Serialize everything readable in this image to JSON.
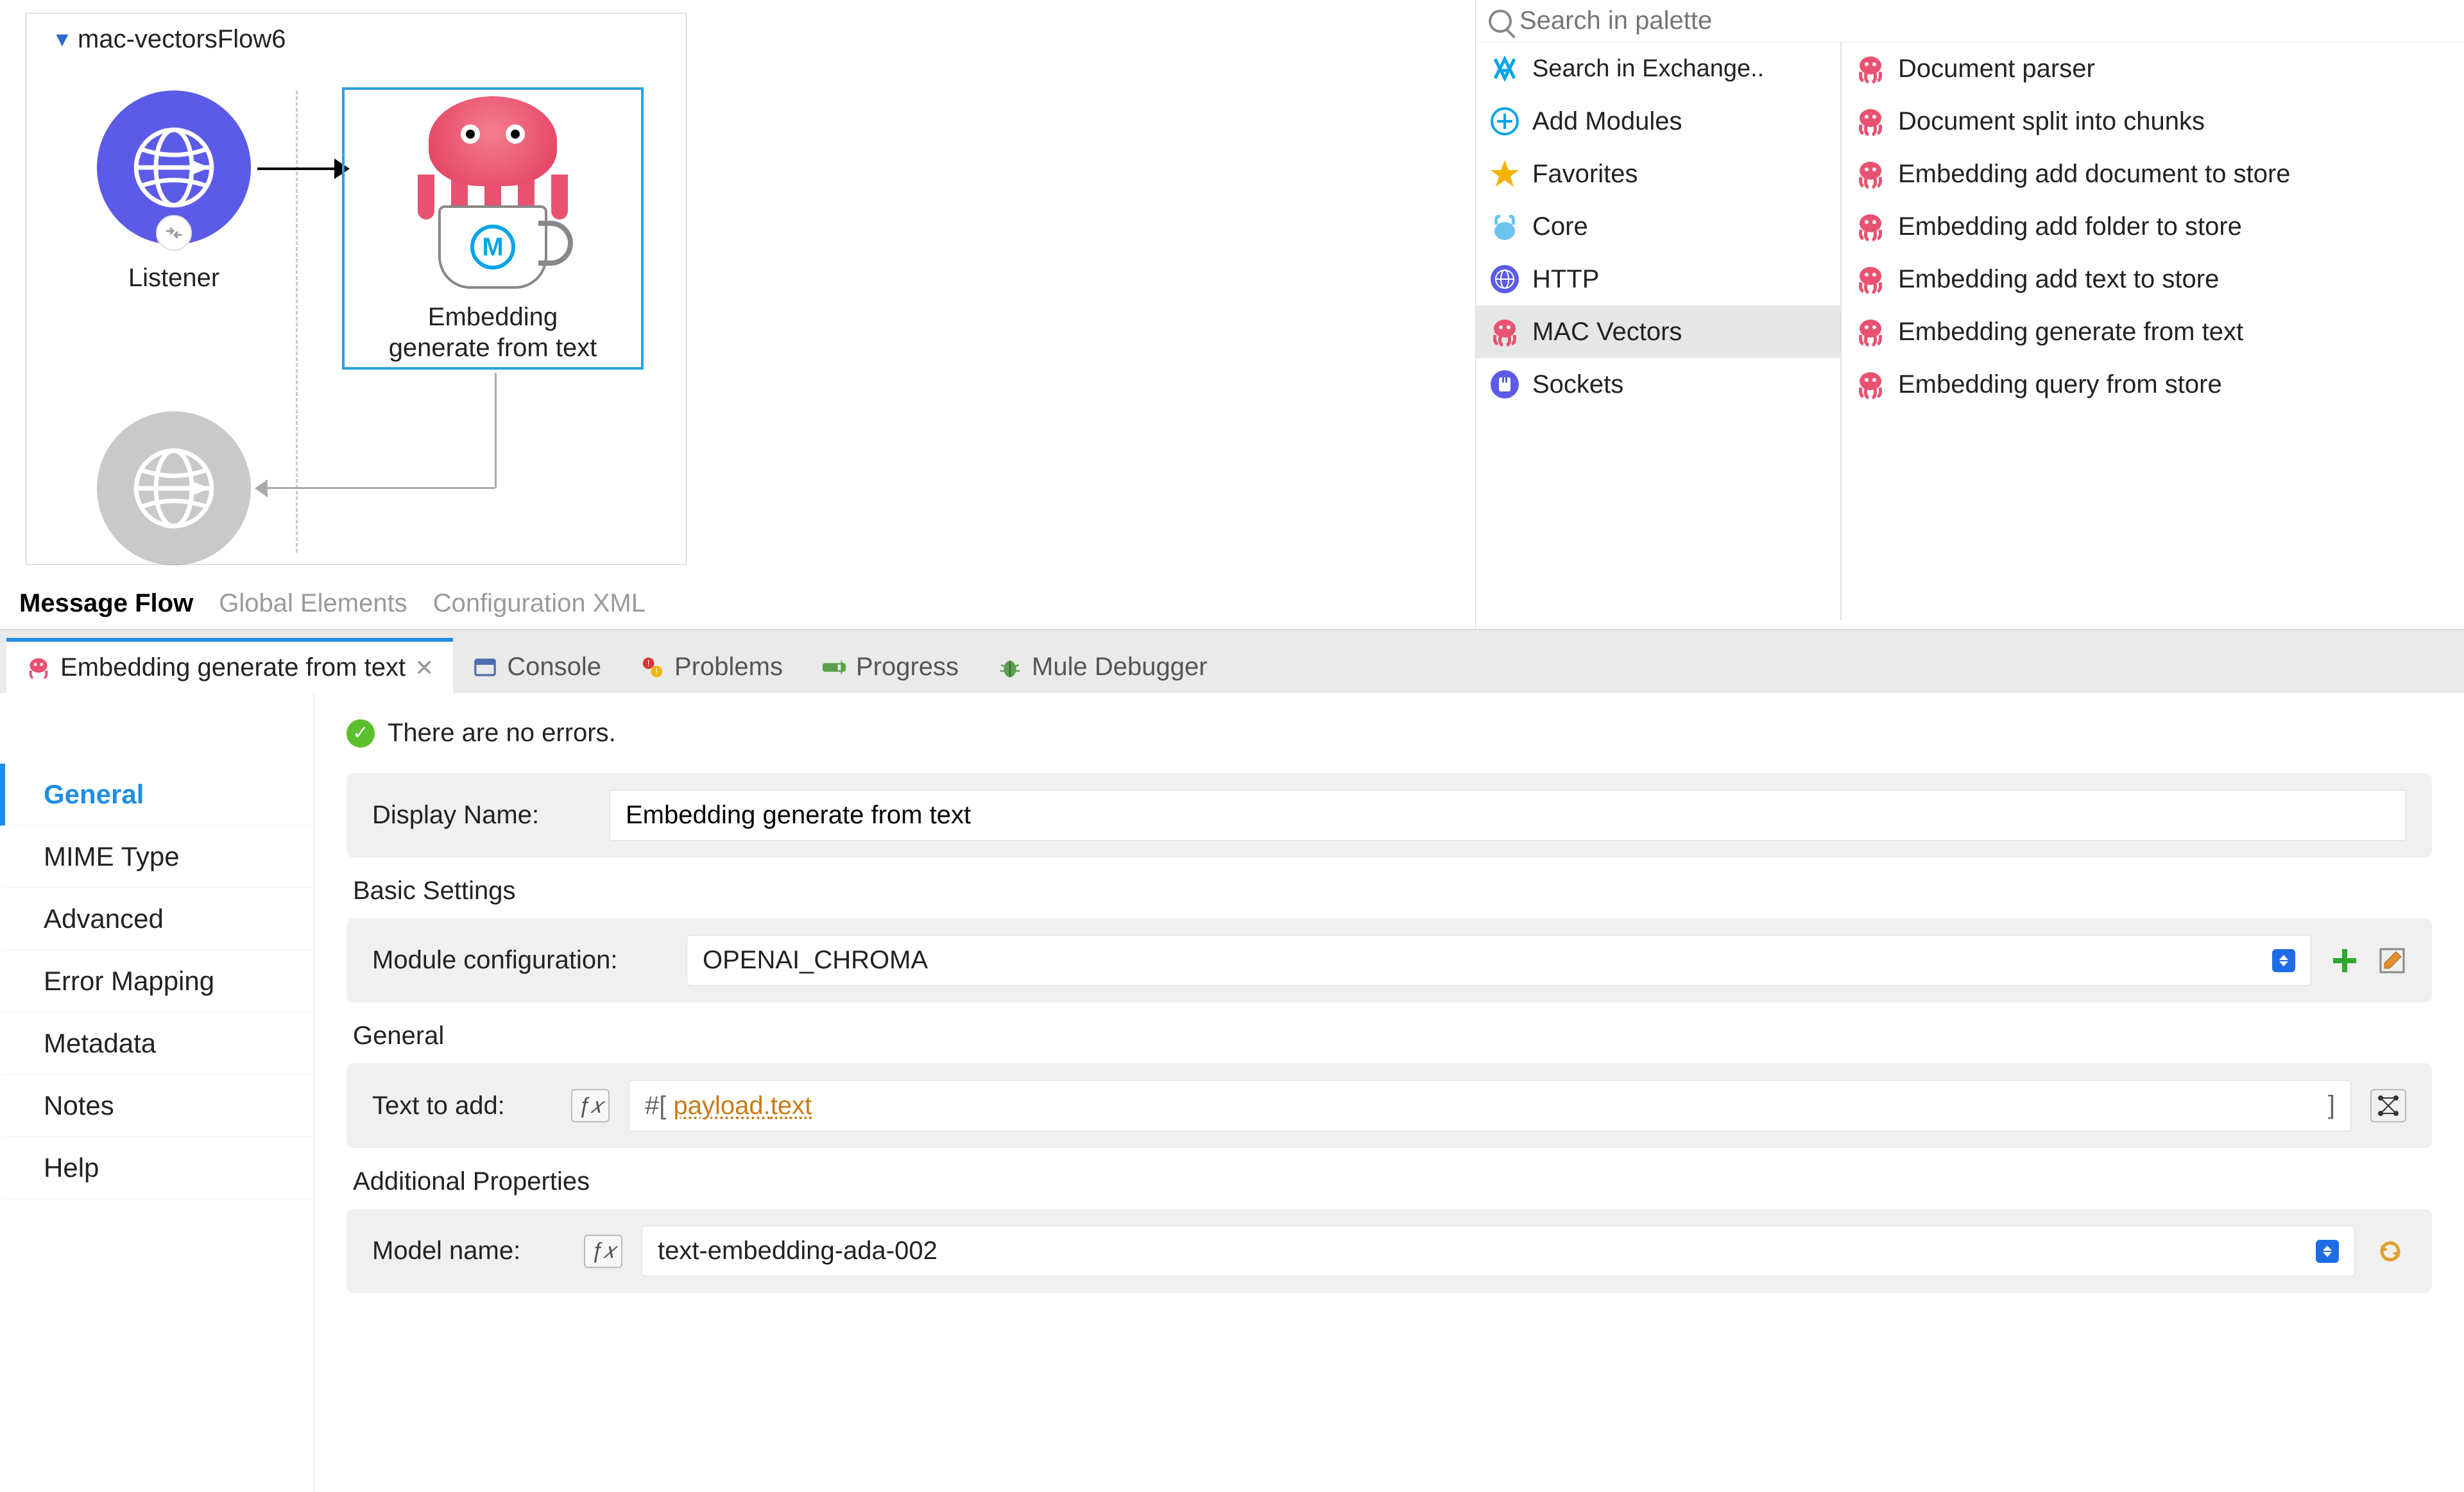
{
  "canvas": {
    "flow_name": "mac-vectorsFlow6",
    "listener_label": "Listener",
    "embedding_label_line1": "Embedding",
    "embedding_label_line2": "generate from text",
    "tabs": [
      {
        "label": "Message Flow",
        "active": true
      },
      {
        "label": "Global Elements",
        "active": false
      },
      {
        "label": "Configuration XML",
        "active": false
      }
    ]
  },
  "palette": {
    "search_placeholder": "Search in palette",
    "left": [
      {
        "label": "Search in Exchange..",
        "icon": "exchange"
      },
      {
        "label": "Add Modules",
        "icon": "plus"
      },
      {
        "label": "Favorites",
        "icon": "star"
      },
      {
        "label": "Core",
        "icon": "bunny"
      },
      {
        "label": "HTTP",
        "icon": "http"
      },
      {
        "label": "MAC Vectors",
        "icon": "octopus",
        "selected": true
      },
      {
        "label": "Sockets",
        "icon": "socket"
      }
    ],
    "right": [
      {
        "label": "Document parser"
      },
      {
        "label": "Document split into chunks"
      },
      {
        "label": "Embedding add document to store"
      },
      {
        "label": "Embedding add folder to store"
      },
      {
        "label": "Embedding add text to store"
      },
      {
        "label": "Embedding generate from text"
      },
      {
        "label": "Embedding query from store"
      }
    ]
  },
  "views": {
    "tabs": [
      {
        "label": "Embedding generate from text",
        "icon": "octopus",
        "active": true,
        "closable": true
      },
      {
        "label": "Console",
        "icon": "console",
        "active": false
      },
      {
        "label": "Problems",
        "icon": "problems",
        "active": false
      },
      {
        "label": "Progress",
        "icon": "progress",
        "active": false
      },
      {
        "label": "Mule Debugger",
        "icon": "debugger",
        "active": false
      }
    ]
  },
  "props": {
    "sidebar": [
      {
        "label": "General",
        "active": true
      },
      {
        "label": "MIME Type"
      },
      {
        "label": "Advanced"
      },
      {
        "label": "Error Mapping"
      },
      {
        "label": "Metadata"
      },
      {
        "label": "Notes"
      },
      {
        "label": "Help"
      }
    ],
    "status_text": "There are no errors.",
    "display_name_label": "Display Name:",
    "display_name_value": "Embedding generate from text",
    "basic_settings_title": "Basic Settings",
    "module_config_label": "Module configuration:",
    "module_config_value": "OPENAI_CHROMA",
    "general_title": "General",
    "text_to_add_label": "Text to add:",
    "text_to_add_expr_prefix": "#[ ",
    "text_to_add_expr_part1": "payload.",
    "text_to_add_expr_part2": "text",
    "text_to_add_expr_suffix": "]",
    "additional_props_title": "Additional Properties",
    "model_name_label": "Model name:",
    "model_name_value": "text-embedding-ada-002"
  }
}
